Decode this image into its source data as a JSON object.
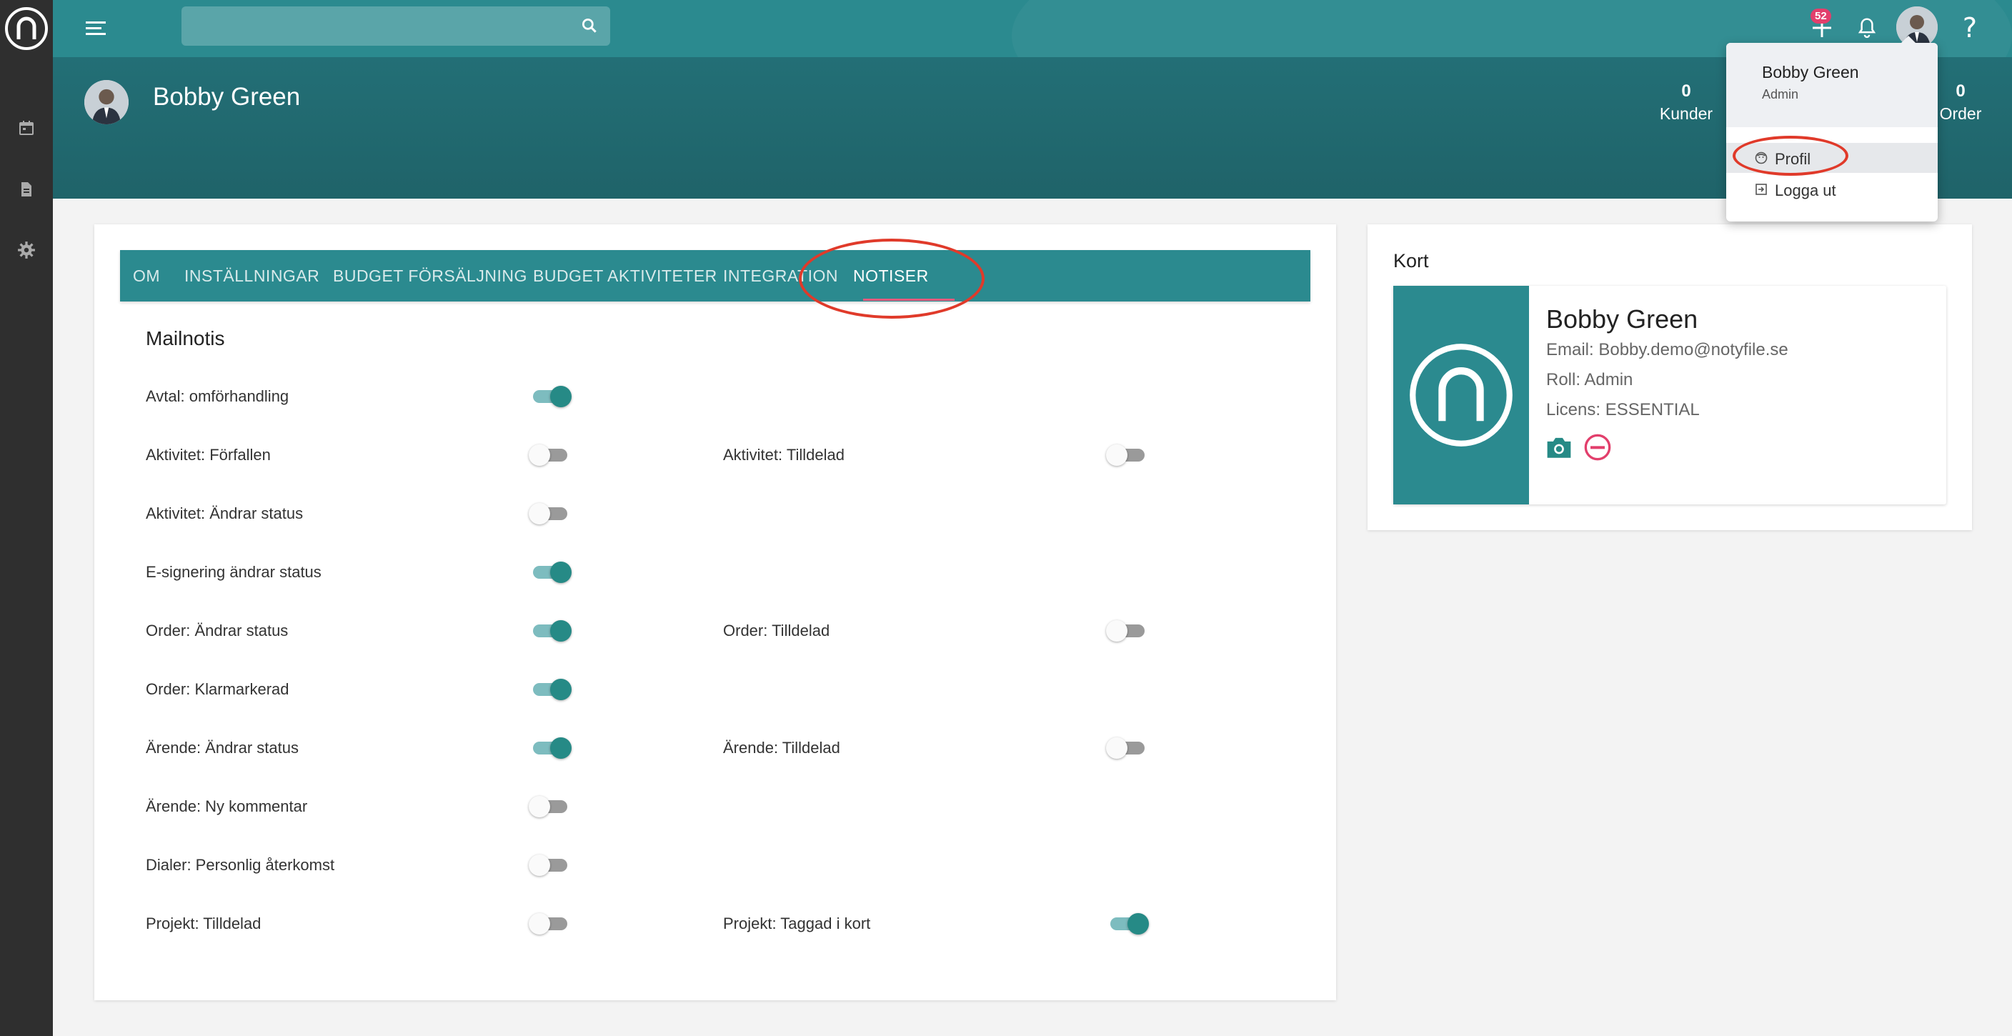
{
  "topbar": {
    "search_placeholder": "",
    "notification_count": "52",
    "icons": [
      "menu-icon",
      "search-icon",
      "plus-icon",
      "bell-icon",
      "help-icon"
    ]
  },
  "rail": {
    "icons": [
      "app-logo",
      "calendar-icon",
      "document-icon",
      "gear-icon"
    ]
  },
  "header": {
    "name": "Bobby Green",
    "stats": [
      {
        "value": "0",
        "label": "Kunder"
      },
      {
        "value": "0",
        "label": "Order"
      }
    ]
  },
  "tabs": [
    {
      "label": "OM"
    },
    {
      "label": "INSTÄLLNINGAR"
    },
    {
      "label": "BUDGET FÖRSÄLJNING"
    },
    {
      "label": "BUDGET AKTIVITETER"
    },
    {
      "label": "INTEGRATION"
    },
    {
      "label": "NOTISER",
      "active": true
    }
  ],
  "mailnotis": {
    "title": "Mailnotis",
    "settings": [
      {
        "label": "Avtal: omförhandling",
        "on": true
      },
      {
        "label": "Aktivitet: Förfallen",
        "on": false
      },
      {
        "label": "Aktivitet: Tilldelad",
        "on": false
      },
      {
        "label": "Aktivitet: Ändrar status",
        "on": false
      },
      {
        "label": "E-signering ändrar status",
        "on": true
      },
      {
        "label": "Order: Ändrar status",
        "on": true
      },
      {
        "label": "Order: Tilldelad",
        "on": false
      },
      {
        "label": "Order: Klarmarkerad",
        "on": true
      },
      {
        "label": "Ärende: Ändrar status",
        "on": true
      },
      {
        "label": "Ärende: Tilldelad",
        "on": false
      },
      {
        "label": "Ärende: Ny kommentar",
        "on": false
      },
      {
        "label": "Dialer: Personlig återkomst",
        "on": false
      },
      {
        "label": "Projekt: Tilldelad",
        "on": false
      },
      {
        "label": "Projekt: Taggad i kort",
        "on": true
      }
    ]
  },
  "kort": {
    "title": "Kort",
    "name": "Bobby Green",
    "email": "Email: Bobby.demo@notyfile.se",
    "role": "Roll: Admin",
    "license": "Licens: ESSENTIAL",
    "action_icons": [
      "camera-icon",
      "remove-circle-icon"
    ]
  },
  "dropdown": {
    "name": "Bobby Green",
    "role": "Admin",
    "items": [
      {
        "label": "Profil",
        "icon": "face-icon"
      },
      {
        "label": "Logga ut",
        "icon": "logout-icon"
      }
    ]
  },
  "colors": {
    "primary": "#2b8a8f",
    "header": "#236f76",
    "rail": "#2f2f2f",
    "toggle_on": "#268a86",
    "accent_pink": "#e85a7c",
    "badge": "#e23f6c",
    "annotation": "#e03a2a"
  }
}
